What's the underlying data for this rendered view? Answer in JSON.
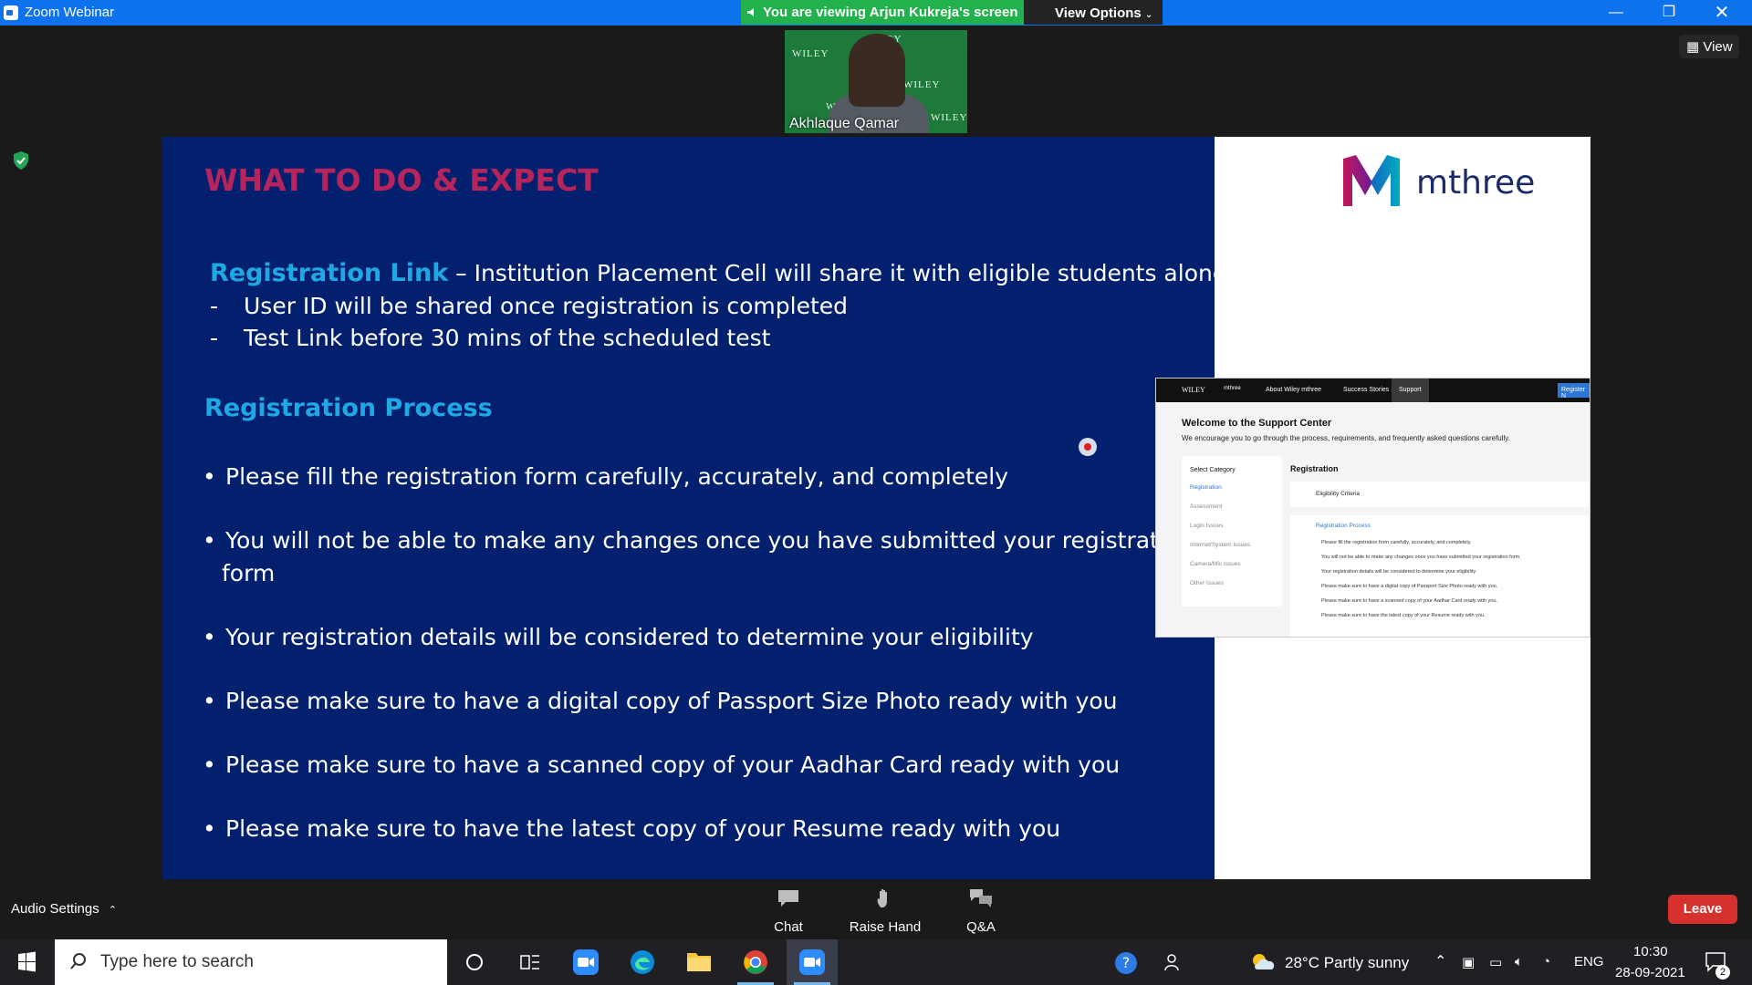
{
  "window": {
    "title": "Zoom Webinar"
  },
  "banner": {
    "viewing_text": "You are viewing Arjun Kukreja's screen",
    "view_options": "View Options",
    "view_label": "View"
  },
  "video": {
    "participant_name": "Akhlaque Qamar",
    "bg_text": "WILEY"
  },
  "slide": {
    "heading": "WHAT TO DO & EXPECT",
    "reg_link_label": "Registration Link",
    "reg_link_text": " – Institution Placement Cell will share it with eligible students alone",
    "dash_items": [
      "User ID will be shared once registration is completed",
      "Test Link before 30 mins of the scheduled test"
    ],
    "process_heading": "Registration Process",
    "bullets": [
      "Please fill the registration form carefully, accurately, and completely",
      "You will not be able to make any changes once you have submitted your  registration",
      "form",
      "Your registration details will be considered to determine your eligibility",
      "Please make sure to have a digital copy of Passport Size Photo ready with you",
      "Please make sure to have a scanned copy of your Aadhar Card ready with you",
      "Please make sure to have the latest copy of your Resume ready with you"
    ],
    "brand": "mthree"
  },
  "website": {
    "nav_brand": "WILEY",
    "nav_brand2": "mthree",
    "nav_items": [
      "About Wiley mthree",
      "Success Stories",
      "Support"
    ],
    "register_btn": "Register N",
    "welcome": "Welcome to the Support Center",
    "subtitle": "We encourage you to go through the process, requirements, and frequently asked questions carefully.",
    "select_category": "Select Category",
    "categories": [
      "Registration",
      "Assessment",
      "Login Issues",
      "Internet/System Issues",
      "Camera/Mic Issues",
      "Other Issues"
    ],
    "panel_title": "Registration",
    "eligibility": "Eligibility Criteria",
    "process_title": "Registration Process",
    "process_items": [
      "Please fill the registration form carefully, accurately, and completely.",
      "You will not be able to make any changes once you have submitted your registration form.",
      "Your registration details will be considered to determine your eligibility.",
      "Please make sure to have a digital copy of Passport Size Photo ready with you.",
      "Please make sure to have a scanned copy of your Aadhar Card ready with you.",
      "Please make sure to have the latest copy of your Resume ready with you."
    ]
  },
  "toolbar": {
    "audio_settings": "Audio Settings",
    "chat": "Chat",
    "raise_hand": "Raise Hand",
    "qa": "Q&A",
    "leave": "Leave"
  },
  "taskbar": {
    "search_placeholder": "Type here to search",
    "weather": "28°C  Partly sunny",
    "lang": "ENG",
    "time": "10:30",
    "date": "28-09-2021",
    "notification_count": "2"
  }
}
